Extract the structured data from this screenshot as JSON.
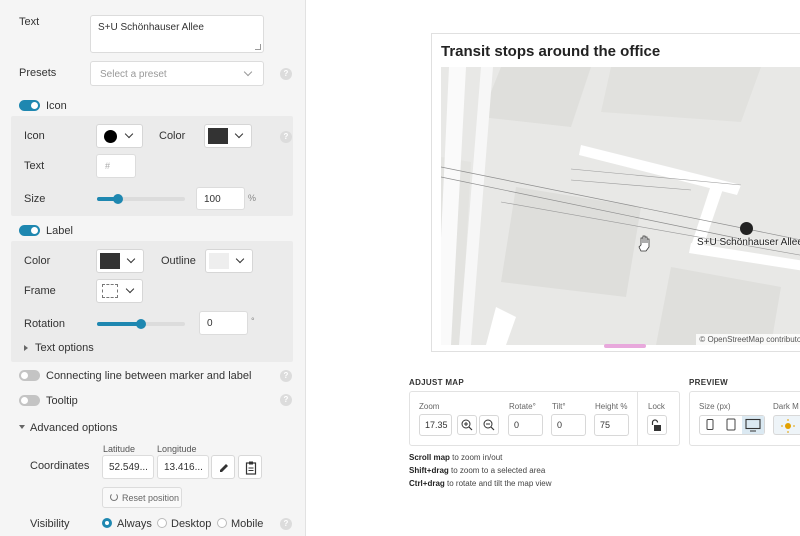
{
  "editor": {
    "text_label": "Text",
    "text_value": "S+U Schönhauser Allee",
    "presets_label": "Presets",
    "presets_placeholder": "Select a preset",
    "help_symbol": "?",
    "icon_section": {
      "toggle_label": "Icon",
      "icon_label": "Icon",
      "color_label": "Color",
      "text_label": "Text",
      "text_placeholder": "#",
      "size_label": "Size",
      "size_value": "100",
      "size_unit": "%",
      "size_slider_level": 0.25,
      "icon_color": "#000000",
      "swatch_color": "#333333"
    },
    "label_section": {
      "toggle_label": "Label",
      "color_label": "Color",
      "outline_label": "Outline",
      "frame_label": "Frame",
      "rotation_label": "Rotation",
      "rotation_value": "0",
      "rotation_unit": "°",
      "rotation_slider_level": 0.5,
      "text_options_label": "Text options",
      "color_swatch": "#333333",
      "outline_swatch": "#eeeeee"
    },
    "connecting_line_label": "Connecting line between marker and label",
    "tooltip_label": "Tooltip",
    "advanced_label": "Advanced options",
    "coordinates_label": "Coordinates",
    "latitude_label": "Latitude",
    "longitude_label": "Longitude",
    "latitude_value": "52.549...",
    "longitude_value": "13.416...",
    "reset_label": "Reset position",
    "visibility_label": "Visibility",
    "visibility_options": [
      "Always",
      "Desktop",
      "Mobile"
    ],
    "visibility_selected": "Always",
    "toggles": {
      "icon": true,
      "label": true,
      "connecting_line": false,
      "tooltip": false
    },
    "accent_color": "#1e87b0"
  },
  "map": {
    "title": "Transit stops around the office",
    "marker_label": "S+U Schönhauser Allee",
    "attribution": "© OpenStreetMap contributors"
  },
  "adjust_map": {
    "heading": "ADJUST MAP",
    "zoom_label": "Zoom",
    "zoom_value": "17.35",
    "rotate_label": "Rotate°",
    "rotate_value": "0",
    "tilt_label": "Tilt°",
    "tilt_value": "0",
    "height_label": "Height %",
    "height_value": "75",
    "lock_label": "Lock",
    "hints": [
      {
        "bold": "Scroll map",
        "rest": " to zoom in/out"
      },
      {
        "bold": "Shift+drag",
        "rest": " to zoom to a selected area"
      },
      {
        "bold": "Ctrl+drag",
        "rest": " to rotate and tilt the map view"
      }
    ]
  },
  "preview": {
    "heading": "PREVIEW",
    "size_label": "Size (px)",
    "dark_mode_label": "Dark M"
  }
}
